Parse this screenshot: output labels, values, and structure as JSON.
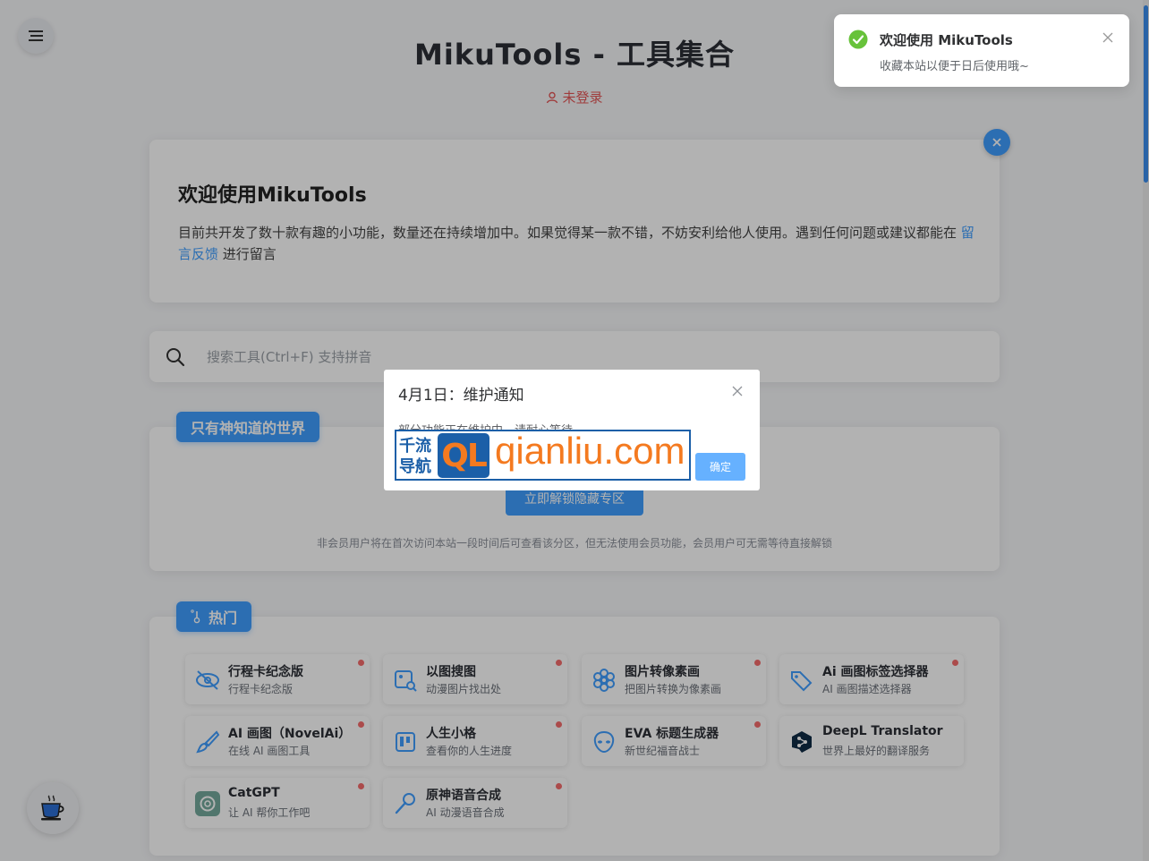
{
  "header": {
    "title": "MikuTools - 工具集合",
    "login_status": "未登录"
  },
  "welcome": {
    "title": "欢迎使用MikuTools",
    "text_before": "目前共开发了数十款有趣的小功能，数量还在持续增加中。如果觉得某一款不错，不妨安利给他人使用。遇到任何问题或建议都能在 ",
    "link": "留言反馈",
    "text_after": " 进行留言"
  },
  "search": {
    "placeholder": "搜索工具(Ctrl+F) 支持拼音"
  },
  "hidden_zone": {
    "tag": "只有神知道的世界",
    "unlock_button": "立即解锁隐藏专区",
    "note": "非会员用户将在首次访问本站一段时间后可查看该分区，但无法使用会员功能，会员用户可无需等待直接解锁"
  },
  "hot": {
    "tag": "热门",
    "tools": [
      {
        "name": "行程卡纪念版",
        "desc": "行程卡纪念版",
        "icon": "eye-slash-icon"
      },
      {
        "name": "以图搜图",
        "desc": "动漫图片找出处",
        "icon": "image-search-icon"
      },
      {
        "name": "图片转像素画",
        "desc": "把图片转换为像素画",
        "icon": "flower-icon"
      },
      {
        "name": "Ai 画图标签选择器",
        "desc": "AI 画图描述选择器",
        "icon": "tags-icon"
      },
      {
        "name": "AI 画图（NovelAi）",
        "desc": "在线 AI 画图工具",
        "icon": "brush-icon"
      },
      {
        "name": "人生小格",
        "desc": "查看你的人生进度",
        "icon": "kanban-icon"
      },
      {
        "name": "EVA 标题生成器",
        "desc": "新世纪福音战士",
        "icon": "alien-face-icon"
      },
      {
        "name": "DeepL Translator",
        "desc": "世界上最好的翻译服务",
        "icon": "deepl-icon"
      },
      {
        "name": "CatGPT",
        "desc": "让 AI 帮你工作吧",
        "icon": "openai-icon"
      },
      {
        "name": "原神语音合成",
        "desc": "AI 动漫语音合成",
        "icon": "microphone-icon"
      }
    ]
  },
  "toast": {
    "title": "欢迎使用 MikuTools",
    "message": "收藏本站以便于日后使用哦~"
  },
  "dialog": {
    "title": "4月1日：维护通知",
    "message": "部分功能正在维护中，请耐心等待",
    "confirm": "确定"
  },
  "watermark": {
    "cn_line1": "千流",
    "cn_line2": "导航",
    "logo": "QL",
    "url": "qianliu.com"
  },
  "colors": {
    "primary": "#409eff",
    "danger": "#f56c6c",
    "success": "#67c23a"
  }
}
